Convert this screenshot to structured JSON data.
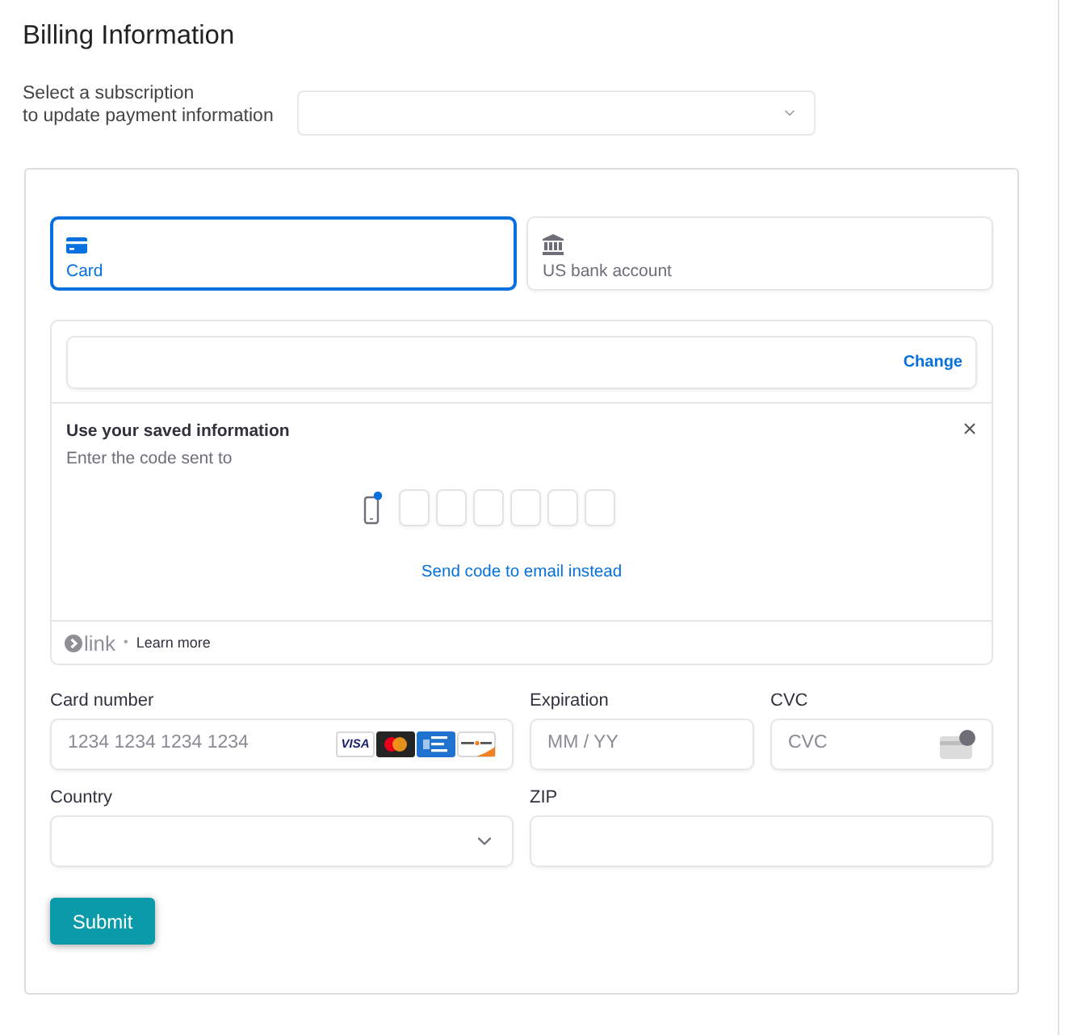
{
  "title": "Billing Information",
  "subscription": {
    "label": "Select a subscription\nto update payment information"
  },
  "payment_methods": [
    {
      "kind": "card",
      "label": "Card",
      "selected": true
    },
    {
      "kind": "bank",
      "label": "US bank account",
      "selected": false
    }
  ],
  "link": {
    "action": "Change",
    "heading": "Use your saved information",
    "subtext": "Enter the code sent to",
    "resend": "Send code to email instead",
    "brand": "link",
    "separator": "•",
    "learn_more": "Learn more"
  },
  "rows": [
    {
      "fields": [
        {
          "kind": "card_number",
          "label": "Card number",
          "placeholder": "1234 1234 1234 1234",
          "brands": [
            {
              "kind": "visa",
              "text": "VISA"
            },
            {
              "kind": "mastercard"
            },
            {
              "kind": "amex"
            },
            {
              "kind": "discover"
            }
          ]
        },
        {
          "kind": "input",
          "label": "Expiration",
          "placeholder": "MM / YY"
        },
        {
          "kind": "cvc",
          "label": "CVC",
          "placeholder": "CVC"
        }
      ]
    },
    {
      "fields": [
        {
          "kind": "select",
          "label": "Country"
        },
        {
          "kind": "input",
          "label": "ZIP"
        }
      ]
    }
  ],
  "submit": "Submit"
}
